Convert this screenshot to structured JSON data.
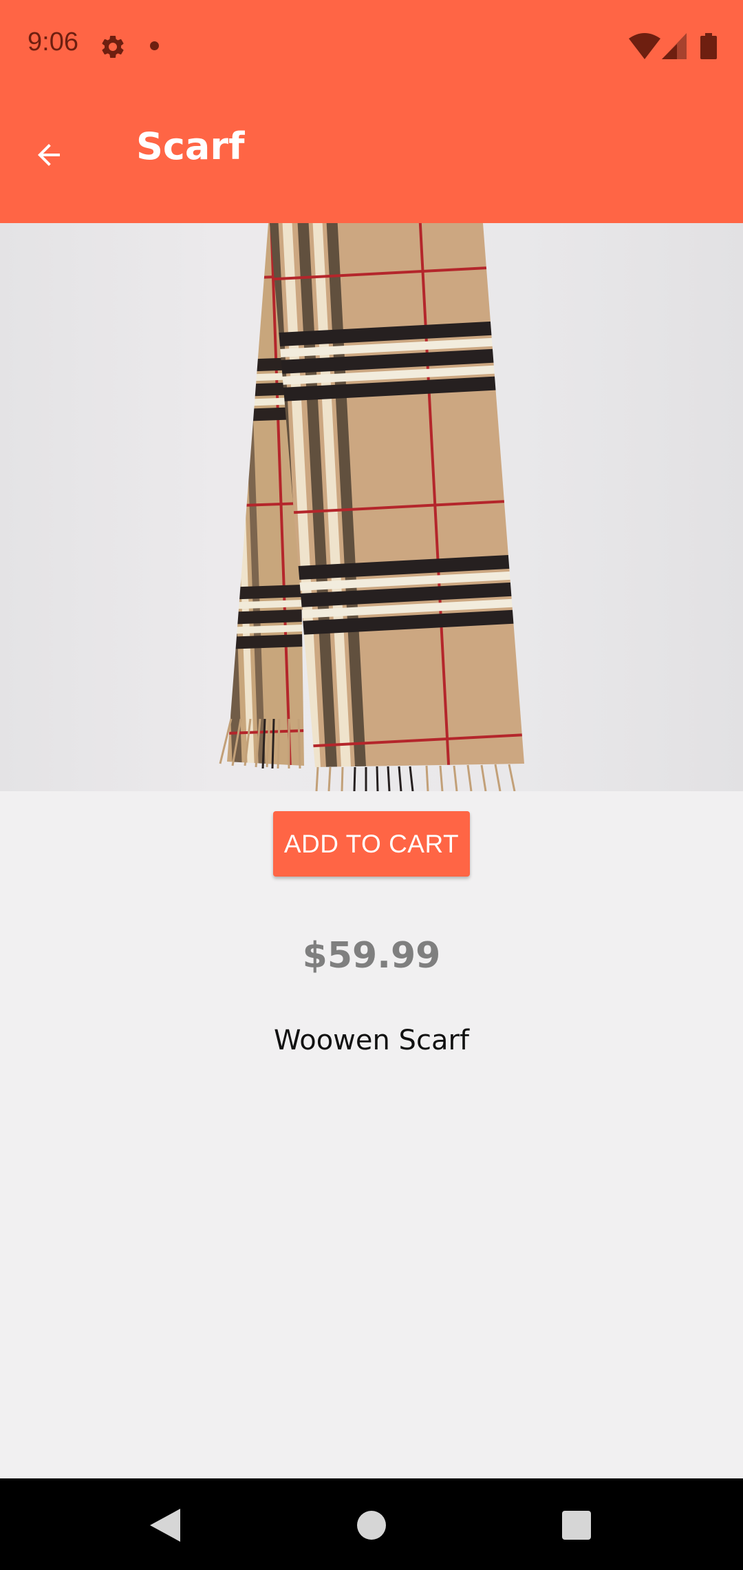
{
  "status_bar": {
    "time": "9:06",
    "icons": [
      "gear-icon",
      "notification-dot-icon",
      "wifi-icon",
      "cell-signal-icon",
      "battery-icon"
    ]
  },
  "app_bar": {
    "back_icon": "arrow-left-icon",
    "title": "Scarf"
  },
  "product": {
    "image_subject": "tartan-scarf",
    "add_to_cart_label": "ADD TO CART",
    "price": "$59.99",
    "name": "Woowen Scarf"
  },
  "nav_bar": {
    "icons": [
      "nav-back-icon",
      "nav-home-icon",
      "nav-recents-icon"
    ]
  },
  "colors": {
    "accent": "#ff6545",
    "status_icon": "#6e1f10",
    "background": "#f1f0f1",
    "price_text": "#7f7f7f"
  }
}
